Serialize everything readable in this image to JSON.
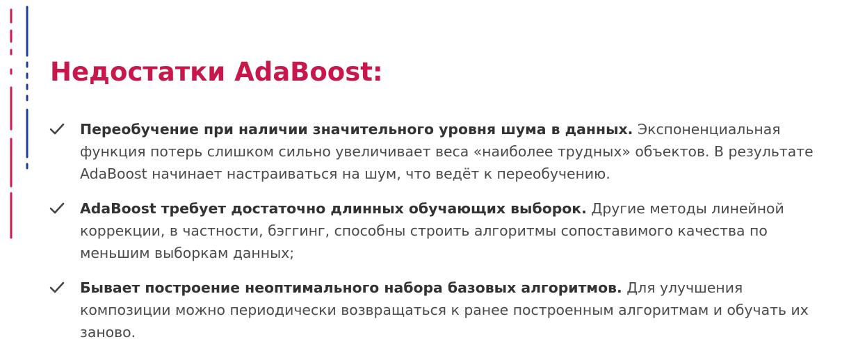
{
  "colors": {
    "title": "#c8174a",
    "accent_red": "#d3194c",
    "accent_blue": "#1b3fa0",
    "text": "#333333",
    "check": "#444444"
  },
  "title": "Недостатки AdaBoost:",
  "items": [
    {
      "icon": "checkmark-icon",
      "bold": "Переобучение при наличии значительного уровня шума в данных.",
      "text": "Экспоненциальная функция потерь слишком сильно увеличивает веса «наиболее трудных» объектов. В результате AdaBoost начинает настраиваться на шум, что ведёт к переобучению."
    },
    {
      "icon": "checkmark-icon",
      "bold": "AdaBoost требует достаточно длинных обучающих выборок.",
      "text": "Другие методы линейной коррекции, в частности, бэггинг, способны строить алгоритмы сопоставимого качества по меньшим выборкам данных;"
    },
    {
      "icon": "checkmark-icon",
      "bold": "Бывает построение неоптимального набора базовых алгоритмов.",
      "text": "Для улучшения композиции можно периодически возвращаться к ранее построенным алгоритмам и обучать их заново."
    }
  ]
}
